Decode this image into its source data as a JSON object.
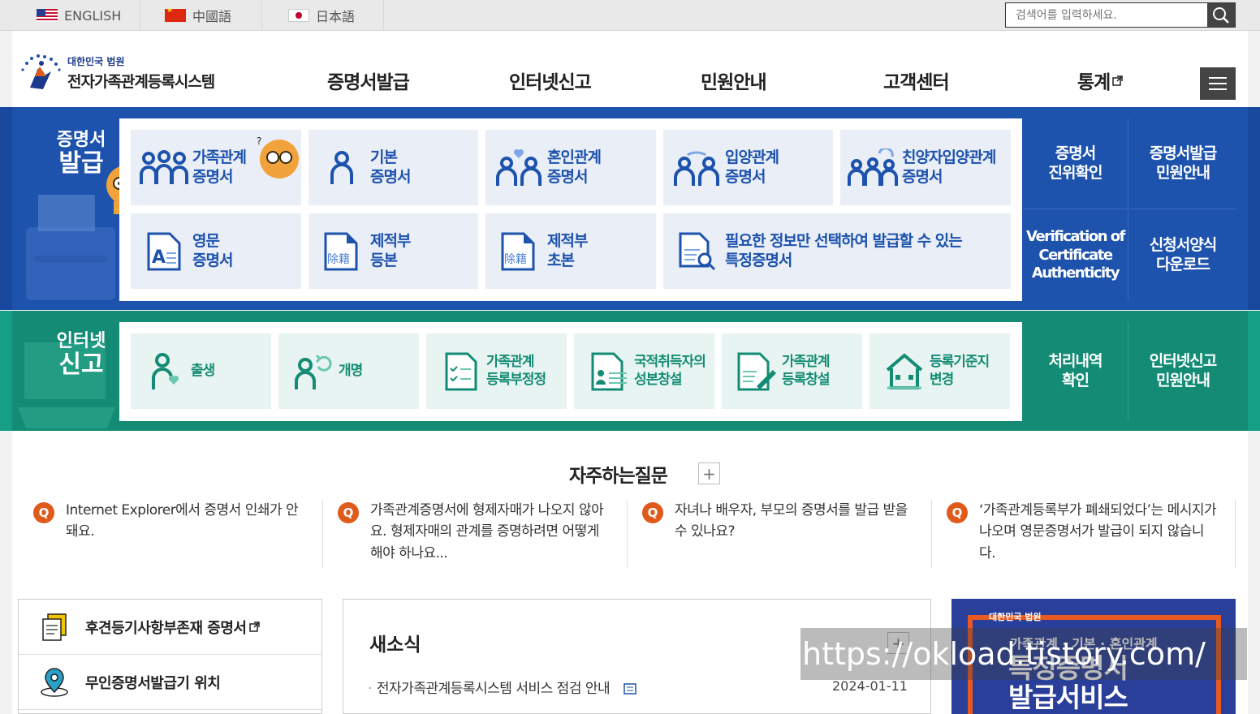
{
  "languages": [
    "ENGLISH",
    "中國語",
    "日本語"
  ],
  "search": {
    "placeholder": "검색어를 입력하세요."
  },
  "logo": {
    "sub": "대한민국 법원",
    "main": "전자가족관계등록시스템"
  },
  "gnb": [
    "증명서발급",
    "인터넷신고",
    "민원안내",
    "고객센터",
    "통계"
  ],
  "cert": {
    "label_line1": "증명서",
    "label_line2": "발급",
    "tiles": [
      {
        "line1": "가족관계",
        "line2": "증명서"
      },
      {
        "line1": "기본",
        "line2": "증명서"
      },
      {
        "line1": "혼인관계",
        "line2": "증명서"
      },
      {
        "line1": "입양관계",
        "line2": "증명서"
      },
      {
        "line1": "친양자입양관계",
        "line2": "증명서"
      },
      {
        "line1": "영문",
        "line2": "증명서"
      },
      {
        "line1": "제적부",
        "line2": "등본"
      },
      {
        "line1": "제적부",
        "line2": "초본"
      },
      {
        "line1": "필요한 정보만 선택하여 발급할 수 있는",
        "line2": "특정증명서"
      }
    ],
    "side": [
      {
        "line1": "증명서",
        "line2": "진위확인"
      },
      {
        "line1": "증명서발급",
        "line2": "민원안내"
      },
      {
        "line1": "Verification of",
        "line2": "Certificate",
        "line3": "Authenticity"
      },
      {
        "line1": "신청서양식",
        "line2": "다운로드"
      }
    ]
  },
  "report": {
    "label_line1": "인터넷",
    "label_line2": "신고",
    "tiles": [
      {
        "line1": "출생",
        "line2": ""
      },
      {
        "line1": "개명",
        "line2": ""
      },
      {
        "line1": "가족관계",
        "line2": "등록부정정"
      },
      {
        "line1": "국적취득자의",
        "line2": "성본창설"
      },
      {
        "line1": "가족관계",
        "line2": "등록창설"
      },
      {
        "line1": "등록기준지",
        "line2": "변경"
      }
    ],
    "side": [
      {
        "line1": "처리내역",
        "line2": "확인"
      },
      {
        "line1": "인터넷신고",
        "line2": "민원안내"
      }
    ]
  },
  "faq": {
    "title": "자주하는질문",
    "badge": "Q",
    "items": [
      {
        "text": "Internet Explorer에서 증명서 인쇄가 안돼요."
      },
      {
        "text": "가족관계증명서에 형제자매가 나오지 않아요. 형제자매의 관계를 증명하려면 어떻게 해야 하나요..."
      },
      {
        "text": "자녀나 배우자, 부모의 증명서를 발급 받을 수 있나요?"
      },
      {
        "text": "‘가족관계등록부가 폐쇄되었다’는 메시지가 나오며 영문증명서가 발급이 되지 않습니다."
      }
    ]
  },
  "quick_links": [
    {
      "label": "후견등기사항부존재 증명서"
    },
    {
      "label": "무인증명서발급기 위치"
    }
  ],
  "news": {
    "title": "새소식",
    "items": [
      {
        "title": "전자가족관계등록시스템 서비스 점검 안내",
        "date": "2024-01-11"
      }
    ]
  },
  "banner": {
    "small": "대한민국 법원",
    "line1": "가족관계 · 기본 · 혼인관계",
    "big1": "특정증명서",
    "big2": "발급서비스"
  },
  "watermark": "https://okload.tistory.com/",
  "colors": {
    "blue": "#1d52ad",
    "green": "#148c75",
    "orange": "#e05a1a"
  }
}
